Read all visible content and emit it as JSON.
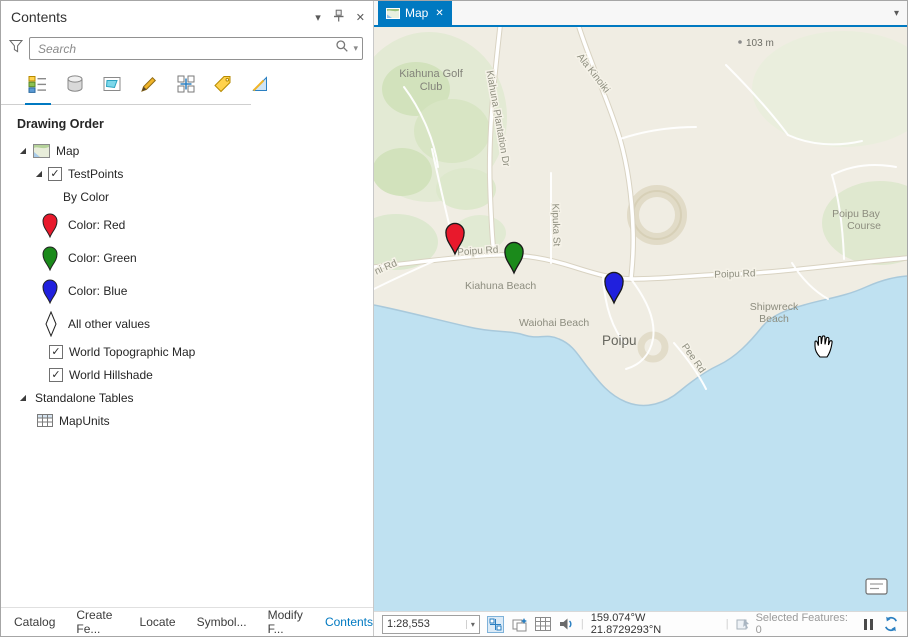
{
  "glyphs": {
    "check": "✓",
    "expander": "◢",
    "caret": "▾",
    "close": "✕"
  },
  "contents_panel": {
    "title": "Contents",
    "search": {
      "placeholder": "Search"
    },
    "section_heading": "Drawing Order",
    "tree": {
      "map": "Map",
      "testpoints": "TestPoints",
      "by_color": "By Color",
      "legend_items": [
        {
          "label": "Color: Red",
          "color": "#e8192c"
        },
        {
          "label": "Color: Green",
          "color": "#1b8a1b"
        },
        {
          "label": "Color: Blue",
          "color": "#2020dd"
        },
        {
          "label": "All other values",
          "color": "#ffffff"
        }
      ],
      "topo": "World Topographic Map",
      "hillshade": "World Hillshade",
      "standalone_tables": "Standalone Tables",
      "mapunits": "MapUnits"
    },
    "bottom_tabs": [
      "Catalog",
      "Create Fe...",
      "Locate",
      "Symbol...",
      "Modify F...",
      "Contents"
    ],
    "active_bottom_tab": "Contents"
  },
  "map_view": {
    "tab": "Map",
    "map_labels": {
      "elevation": "103 m",
      "golf_line1": "Kiahuna Golf",
      "golf_line2": "Club",
      "plantation_dr": "Kiahuna Plantation Dr",
      "ala_kinoiki": "Ala Kinoiki",
      "kipuka": "Kipuka St",
      "poipu_rd_1": "Poipu Rd",
      "poipu_rd_2": "Poipu Rd",
      "kiahuna_beach": "Kiahuna Beach",
      "waiohai_beach": "Waiohai Beach",
      "poipu": "Poipu",
      "shipwreck_line1": "Shipwreck",
      "shipwreck_line2": "Beach",
      "bay_course_line1": "Poipu Bay",
      "bay_course_line2": "Course",
      "pee_rd": "Pee Rd",
      "ni_rd": "ni Rd"
    },
    "status_bar": {
      "scale": "1:28,553",
      "coordinates": "159.074°W 21.8729293°N",
      "selected_features": "Selected Features: 0"
    },
    "colors": {
      "ocean": "#bfe1f1",
      "land": "#f0ede3",
      "accent_blue": "#0079c1"
    }
  }
}
